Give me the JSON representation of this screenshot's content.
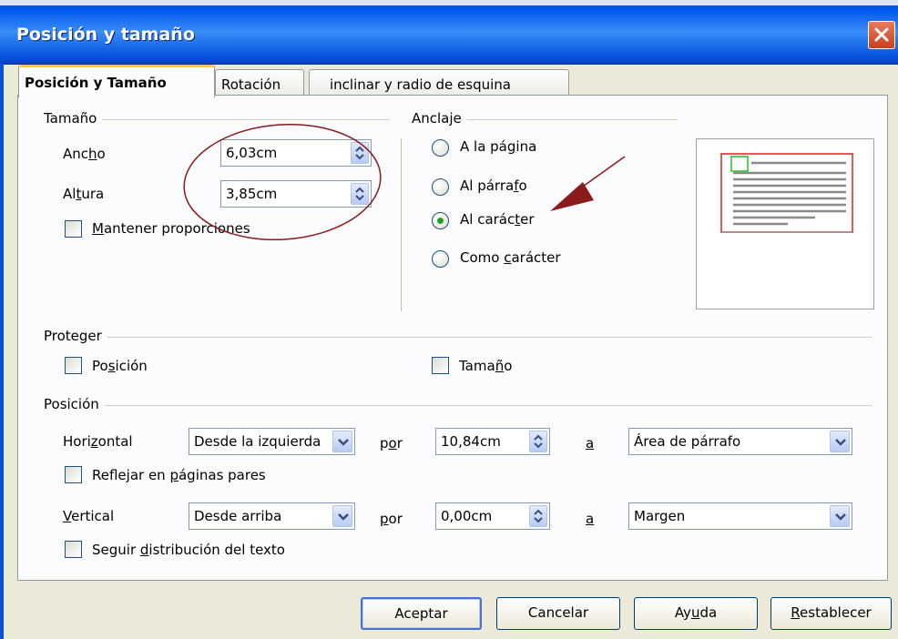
{
  "window": {
    "title": "Posición y tamaño"
  },
  "tabs": [
    {
      "label": "Posición y Tamaño",
      "active": true
    },
    {
      "label": "Rotación",
      "active": false
    },
    {
      "label": "inclinar y radio de esquina",
      "active": false
    }
  ],
  "size": {
    "group_label": "Tamaño",
    "width_label": "Ancho",
    "width_value": "6,03cm",
    "height_label": "Altura",
    "height_value": "3,85cm",
    "keep_ratio_label": "Mantener proporciones",
    "keep_ratio_checked": false
  },
  "anchor": {
    "group_label": "Anclaje",
    "options": [
      {
        "label": "A la página",
        "selected": false
      },
      {
        "label": "Al párrafo",
        "selected": false
      },
      {
        "label": "Al carácter",
        "selected": true
      },
      {
        "label": "Como carácter",
        "selected": false
      }
    ]
  },
  "protect": {
    "group_label": "Proteger",
    "position_label": "Posición",
    "size_label": "Tamaño"
  },
  "position": {
    "group_label": "Posición",
    "horizontal": {
      "label": "Horizontal",
      "from": "Desde la izquierda",
      "by_label": "por",
      "by_value": "10,84cm",
      "to_label": "a",
      "to": "Área de párrafo"
    },
    "mirror_label": "Reflejar en páginas pares",
    "vertical": {
      "label": "Vertical",
      "from": "Desde arriba",
      "by_label": "por",
      "by_value": "0,00cm",
      "to_label": "a",
      "to": "Margen"
    },
    "follow_text_label": "Seguir distribución del texto"
  },
  "buttons": {
    "ok": "Aceptar",
    "cancel": "Cancelar",
    "help": "Ayuda",
    "reset": "Restablecer"
  },
  "colors": {
    "annotation": "#8b1a1a",
    "radio_selected": "#21a121",
    "preview_frame": "#e02020",
    "preview_anchor": "#22c022"
  }
}
